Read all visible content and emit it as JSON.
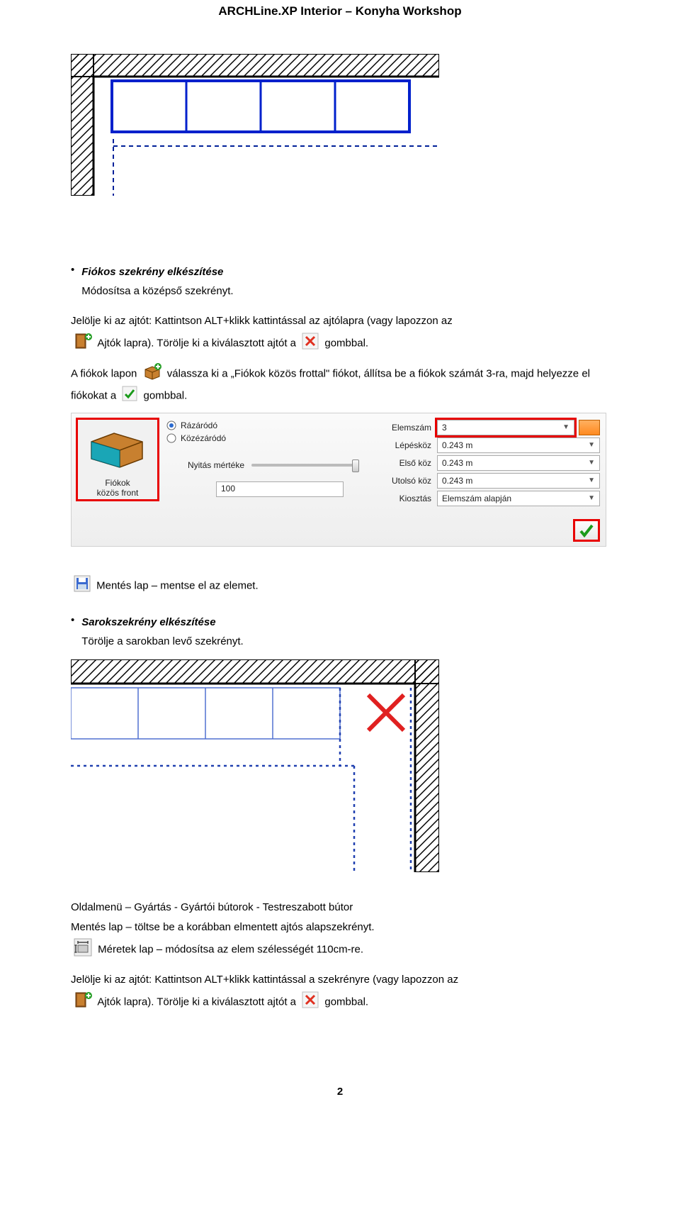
{
  "header": {
    "title": "ARCHLine.XP Interior – Konyha Workshop"
  },
  "section1": {
    "heading": "Fiókos szekrény elkészítése",
    "sub": "Módosítsa a középső szekrényt.",
    "p1a": "Jelölje ki az ajtót: Kattintson ALT+klikk kattintással az ajtólapra (vagy lapozzon az",
    "p1b": " Ajtók lapra). Törölje ki a kiválasztott ajtót a ",
    "p1c": " gombbal.",
    "p2a": "A fiókok lapon ",
    "p2b": " válassza ki a „Fiókok közös frottal\" fiókot, állítsa be a fiókok számát 3-ra, majd helyezze el fiókokat a ",
    "p2c": " gombbal."
  },
  "ui": {
    "thumb_label1": "Fiókok",
    "thumb_label2": "közös front",
    "radio1": "Rázáródó",
    "radio2": "Közézáródó",
    "slider_label": "Nyitás mértéke",
    "num_value": "100",
    "props": {
      "elemszam_label": "Elemszám",
      "elemszam_value": "3",
      "lepeskoz_label": "Lépésköz",
      "lepeskoz_value": "0.243 m",
      "elsokoz_label": "Első köz",
      "elsokoz_value": "0.243 m",
      "utolsokoz_label": "Utolsó köz",
      "utolsokoz_value": "0.243 m",
      "kiosztas_label": "Kiosztás",
      "kiosztas_value": "Elemszám alapján"
    }
  },
  "section2": {
    "save_line": " Mentés lap – mentse el az elemet.",
    "heading": "Sarokszekrény elkészítése",
    "sub": "Törölje a sarokban levő szekrényt."
  },
  "section3": {
    "p1": "Oldalmenü – Gyártás - Gyártói bútorok - Testreszabott bútor",
    "p2": "Mentés lap – töltse be a korábban elmentett ajtós alapszekrényt.",
    "p3": " Méretek lap – módosítsa az elem szélességét 110cm-re.",
    "p4": "Jelölje ki az ajtót: Kattintson ALT+klikk kattintással a szekrényre (vagy lapozzon az",
    "p5": " Ajtók lapra). Törölje ki a kiválasztott ajtót a ",
    "p6": " gombbal."
  },
  "page_number": "2"
}
